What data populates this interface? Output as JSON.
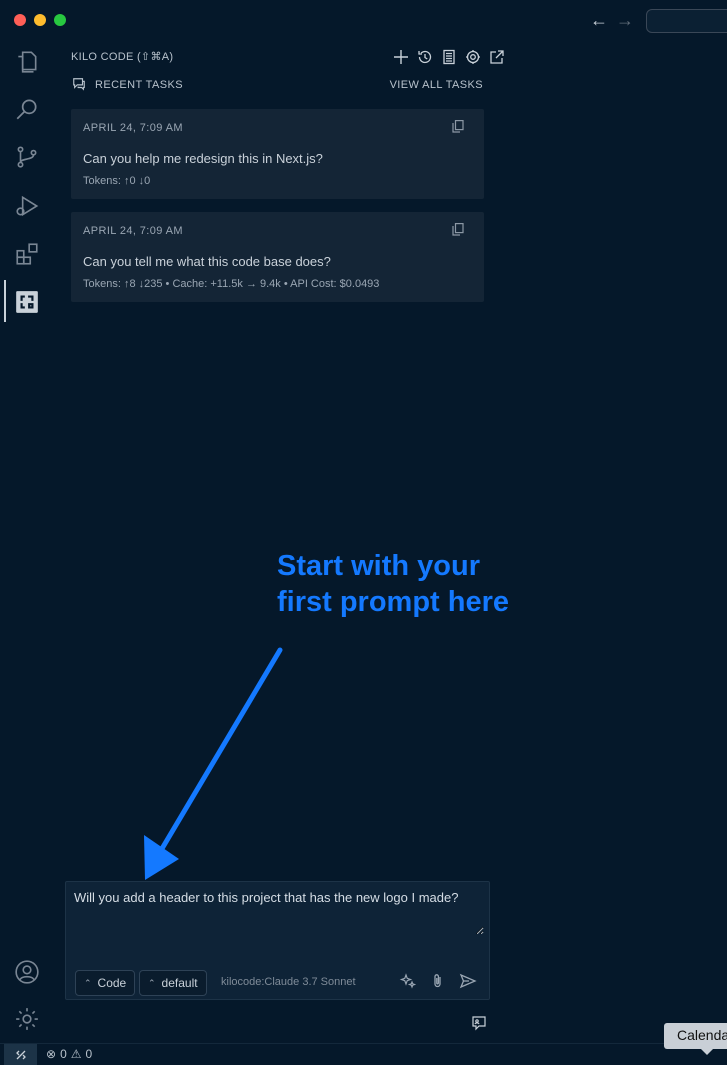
{
  "header": {
    "title": "KILO CODE (⇧⌘A)",
    "tools": [
      "plus-icon",
      "history-icon",
      "marketplace-icon",
      "settings-icon",
      "popout-icon"
    ]
  },
  "recent": {
    "label": "RECENT TASKS",
    "view_all": "VIEW ALL TASKS"
  },
  "tasks": [
    {
      "date": "APRIL 24, 7:09 AM",
      "text": "Can you help me redesign this in Next.js?",
      "meta": "Tokens: ↑0 ↓0"
    },
    {
      "date": "APRIL 24, 7:09 AM",
      "text": "Can you tell me what this code base does?",
      "meta": "Tokens: ↑8 ↓235 • Cache: +11.5k → 9.4k • API Cost: $0.0493"
    }
  ],
  "annotation": {
    "line1": "Start with your",
    "line2": "first prompt here",
    "color": "#1479ff"
  },
  "chat": {
    "value": "Will you add a header to this project that has the new logo I made?",
    "mode": "Code",
    "profile": "default",
    "model": "kilocode:Claude 3.7 Sonnet"
  },
  "status": {
    "errors": "0",
    "warnings": "0"
  },
  "tooltip": {
    "text": "Calendar"
  }
}
